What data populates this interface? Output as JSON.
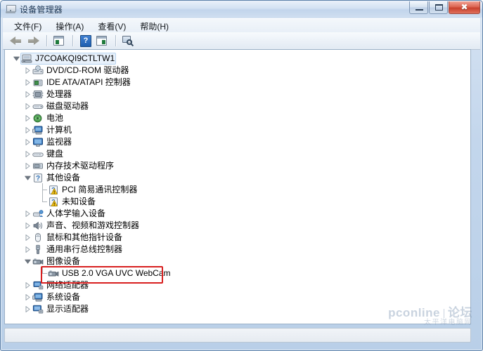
{
  "window": {
    "title": "设备管理器",
    "title_icon": "device-manager-icon",
    "buttons": {
      "minimize": "最小化",
      "maximize": "最大化",
      "close": "✖"
    }
  },
  "menubar": {
    "items": [
      {
        "label": "文件(F)"
      },
      {
        "label": "操作(A)"
      },
      {
        "label": "查看(V)"
      },
      {
        "label": "帮助(H)"
      }
    ]
  },
  "toolbar": {
    "items": [
      {
        "name": "back-arrow-icon",
        "label": "后退"
      },
      {
        "name": "forward-arrow-icon",
        "label": "前进"
      },
      {
        "name": "separator-1",
        "label": ""
      },
      {
        "name": "show-hide-console-tree-icon",
        "label": "显示/隐藏控制台树"
      },
      {
        "name": "help-icon",
        "label": "?"
      },
      {
        "name": "properties-pane-icon",
        "label": "属性"
      },
      {
        "name": "separator-2",
        "label": ""
      },
      {
        "name": "scan-hardware-changes-icon",
        "label": "扫描检测硬件改动"
      }
    ]
  },
  "tree": {
    "root": {
      "label": "J7COAKQI9CTLTW1",
      "icon": "computer-icon",
      "expanded": true,
      "selected": true
    },
    "items": [
      {
        "label": "DVD/CD-ROM 驱动器",
        "icon": "dvd-drive-icon",
        "expanded": false,
        "warning": false
      },
      {
        "label": "IDE ATA/ATAPI 控制器",
        "icon": "ide-controller-icon",
        "expanded": false,
        "warning": false
      },
      {
        "label": "处理器",
        "icon": "processor-icon",
        "expanded": false,
        "warning": false
      },
      {
        "label": "磁盘驱动器",
        "icon": "disk-drive-icon",
        "expanded": false,
        "warning": false
      },
      {
        "label": "电池",
        "icon": "battery-icon",
        "expanded": false,
        "warning": false
      },
      {
        "label": "计算机",
        "icon": "computer-node-icon",
        "expanded": false,
        "warning": false
      },
      {
        "label": "监视器",
        "icon": "monitor-icon",
        "expanded": false,
        "warning": false
      },
      {
        "label": "键盘",
        "icon": "keyboard-icon",
        "expanded": false,
        "warning": false
      },
      {
        "label": "内存技术驱动程序",
        "icon": "memory-technology-icon",
        "expanded": false,
        "warning": false
      },
      {
        "label": "其他设备",
        "icon": "unknown-device-icon",
        "expanded": true,
        "warning": false,
        "children": [
          {
            "label": "PCI 简易通讯控制器",
            "icon": "warning-device-icon",
            "warning": true
          },
          {
            "label": "未知设备",
            "icon": "warning-device-icon",
            "warning": true
          }
        ]
      },
      {
        "label": "人体学输入设备",
        "icon": "hid-icon",
        "expanded": false,
        "warning": false
      },
      {
        "label": "声音、视频和游戏控制器",
        "icon": "sound-video-game-icon",
        "expanded": false,
        "warning": false
      },
      {
        "label": "鼠标和其他指针设备",
        "icon": "mouse-icon",
        "expanded": false,
        "warning": false
      },
      {
        "label": "通用串行总线控制器",
        "icon": "usb-controller-icon",
        "expanded": false,
        "warning": false
      },
      {
        "label": "图像设备",
        "icon": "imaging-device-icon",
        "expanded": true,
        "warning": false,
        "children": [
          {
            "label": "USB 2.0 VGA UVC WebCam",
            "icon": "webcam-icon",
            "warning": false,
            "highlighted": true
          }
        ]
      },
      {
        "label": "网络适配器",
        "icon": "network-adapter-icon",
        "expanded": false,
        "warning": false
      },
      {
        "label": "系统设备",
        "icon": "system-device-icon",
        "expanded": false,
        "warning": false
      },
      {
        "label": "显示适配器",
        "icon": "display-adapter-icon",
        "expanded": false,
        "warning": false
      }
    ]
  },
  "annotation": {
    "highlight_color": "#d81f1f",
    "target_label": "USB 2.0 VGA UVC WebCam"
  },
  "statusbar": {
    "text": ""
  },
  "watermark": {
    "brand": "pconline",
    "section": "论坛",
    "subtitle": "太平洋电脑网"
  }
}
